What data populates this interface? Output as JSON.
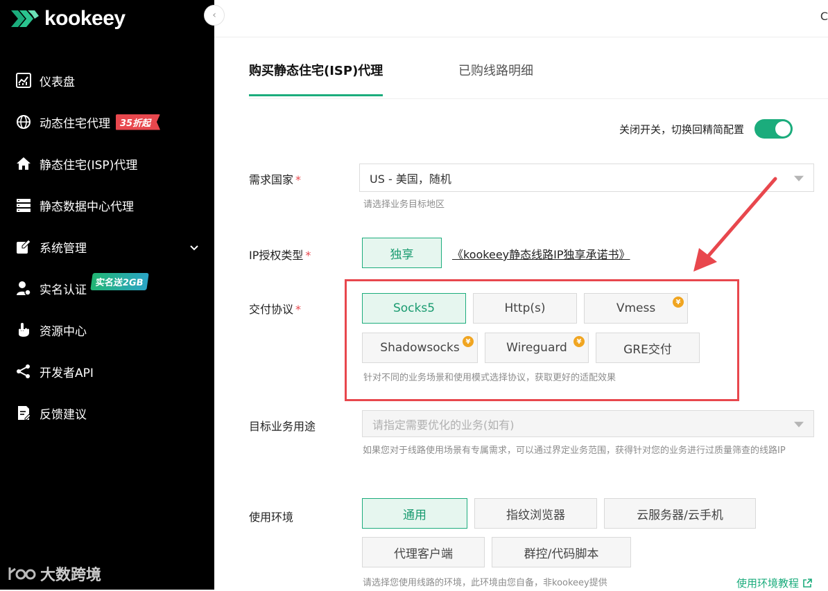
{
  "sidebar": {
    "logo": "kookeey",
    "items": [
      {
        "label": "仪表盘",
        "icon": "dashboard-icon"
      },
      {
        "label": "动态住宅代理",
        "icon": "globe-icon",
        "badge": "35折起"
      },
      {
        "label": "静态住宅(ISP)代理",
        "icon": "home-icon"
      },
      {
        "label": "静态数据中心代理",
        "icon": "server-icon"
      },
      {
        "label": "系统管理",
        "icon": "edit-icon"
      },
      {
        "label": "实名认证",
        "icon": "user-id-icon",
        "badge": "实名送2GB"
      },
      {
        "label": "资源中心",
        "icon": "hand-pointer-icon"
      },
      {
        "label": "开发者API",
        "icon": "share-nodes-icon"
      },
      {
        "label": "反馈建议",
        "icon": "feedback-icon"
      }
    ],
    "watermark": "大数跨境"
  },
  "topbar": {
    "cut_text": "C"
  },
  "tabs": {
    "active": "购买静态住宅(ISP)代理",
    "inactive": "已购线路明细"
  },
  "toggle": {
    "label": "关闭开关，切换回精简配置",
    "on": true,
    "color": "#1bac7c"
  },
  "form": {
    "country": {
      "label": "需求国家",
      "required": "*",
      "value": "US - 美国，随机",
      "hint": "请选择业务目标地区"
    },
    "ip_auth": {
      "label": "IP授权类型",
      "required": "*",
      "option": "独享",
      "doc_link": "《kookeey静态线路IP独享承诺书》"
    },
    "protocol": {
      "label": "交付协议",
      "required": "*",
      "options": [
        "Socks5",
        "Http(s)",
        "Vmess",
        "Shadowsocks",
        "Wireguard",
        "GRE交付"
      ],
      "paid_marker": "¥",
      "hint": "针对不同的业务场景和使用模式选择协议，获取更好的适配效果"
    },
    "target": {
      "label": "目标业务用途",
      "placeholder": "请指定需要优化的业务(如有)",
      "hint": "如果您对于线路使用场景有专属需求，可以通过界定业务范围，获得针对您的业务进行过质量筛查的线路IP"
    },
    "env": {
      "label": "使用环境",
      "options": [
        "通用",
        "指纹浏览器",
        "云服务器/云手机",
        "代理客户端",
        "群控/代码脚本"
      ],
      "hint": "请选择您使用线路的环境，此环境由您自备，非kookeey提供",
      "tutorial_link": "使用环境教程"
    }
  },
  "colors": {
    "accent": "#1bac7c",
    "highlight": "#e8474d"
  }
}
